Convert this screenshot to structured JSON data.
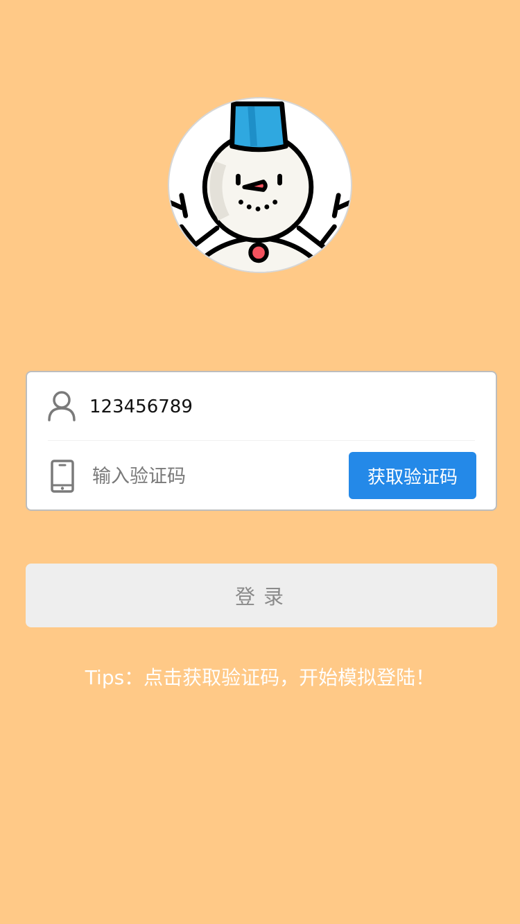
{
  "avatar": {
    "icon": "snowman-icon"
  },
  "form": {
    "phone": {
      "icon": "user-icon",
      "value": "123456789"
    },
    "code": {
      "icon": "mobile-phone-icon",
      "placeholder": "输入验证码",
      "get_code_label": "获取验证码"
    }
  },
  "login": {
    "label": "登录"
  },
  "tips": {
    "text": "Tips：点击获取验证码，开始模拟登陆！"
  },
  "colors": {
    "background": "#FFC987",
    "primary_button": "#2489E8",
    "login_button": "#EEEEEE"
  }
}
